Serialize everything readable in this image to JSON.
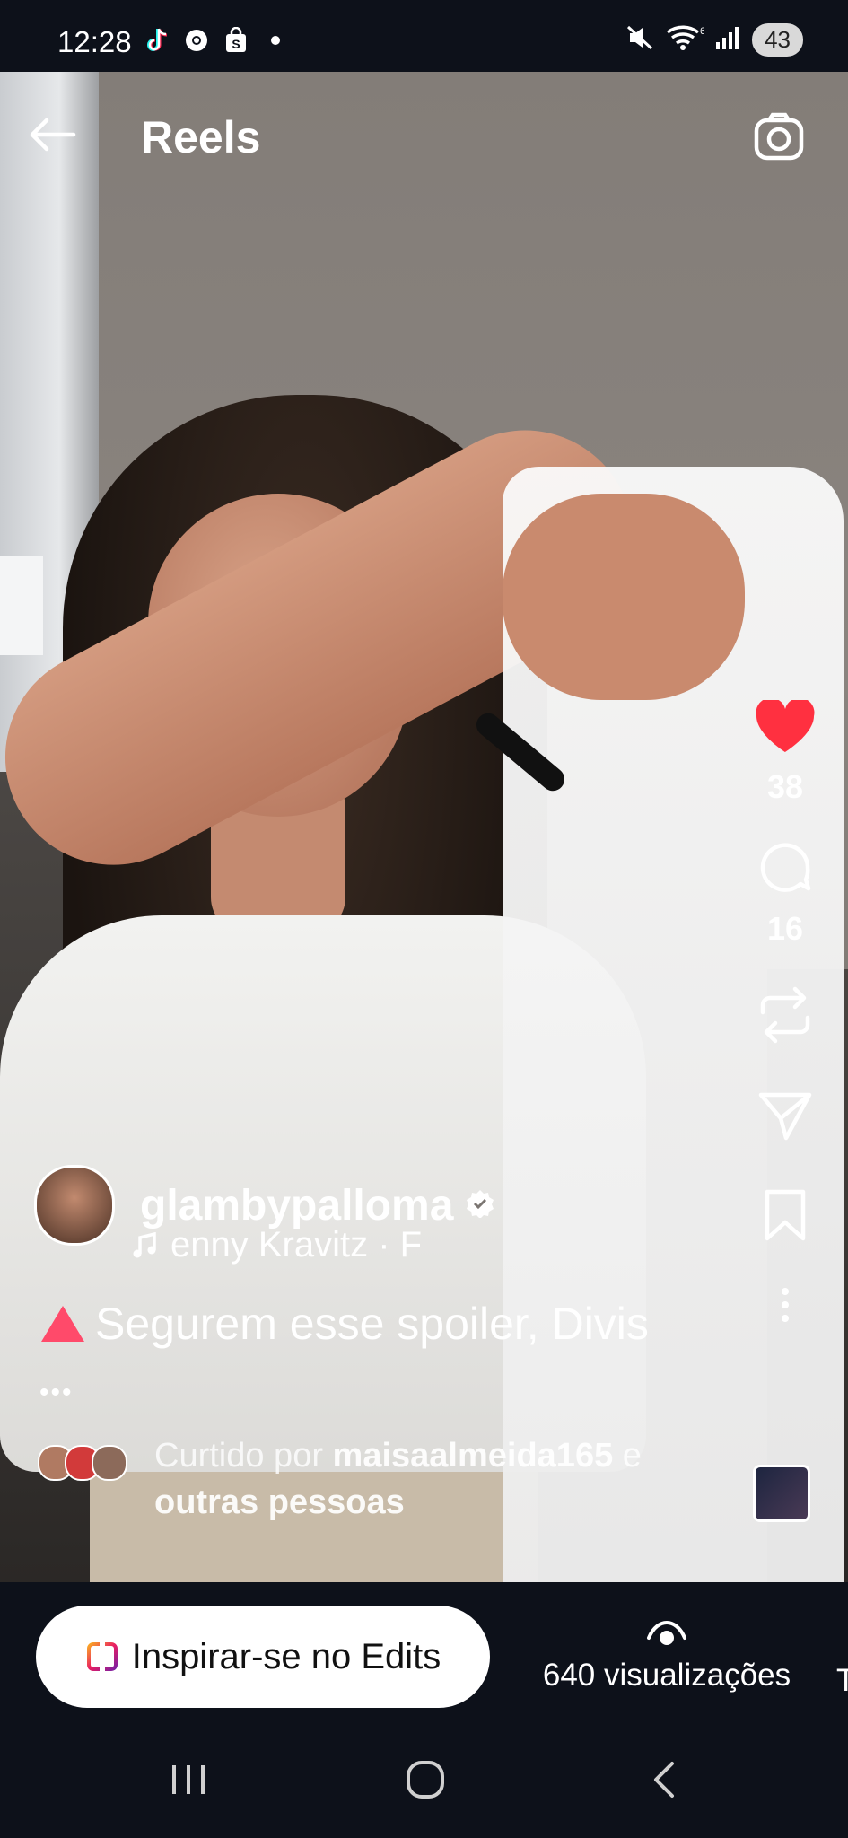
{
  "status_bar": {
    "time": "12:28",
    "left_icons": [
      "tiktok-icon",
      "chrome-icon",
      "shopping-icon"
    ],
    "battery": "43"
  },
  "header": {
    "title": "Reels"
  },
  "actions": {
    "likes": "38",
    "comments": "16",
    "like_color": "#ff3040"
  },
  "post": {
    "username": "glambypalloma",
    "music": "enny Kravitz · F",
    "caption": "Segurem esse spoiler, Divis",
    "more": "•••",
    "liked_by_prefix": "Curtido por ",
    "liked_by_user": "maisaalmeida165",
    "liked_by_joiner": " e",
    "liked_by_others": "outras pessoas"
  },
  "bottom": {
    "edits_label": "Inspirar-se no Edits",
    "views": "640 visualizações",
    "truncated_next": "T"
  }
}
